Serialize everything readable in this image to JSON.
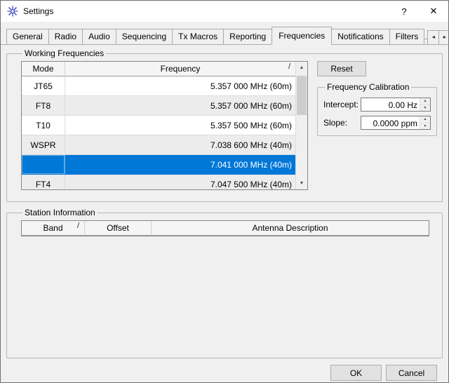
{
  "window": {
    "title": "Settings"
  },
  "titlebar": {
    "help": "?",
    "close": "✕"
  },
  "tabs": {
    "items": [
      {
        "label": "General"
      },
      {
        "label": "Radio"
      },
      {
        "label": "Audio"
      },
      {
        "label": "Sequencing"
      },
      {
        "label": "Tx Macros"
      },
      {
        "label": "Reporting"
      },
      {
        "label": "Frequencies"
      },
      {
        "label": "Notifications"
      },
      {
        "label": "Filters"
      }
    ],
    "active": "Frequencies"
  },
  "icons": {
    "scroll_left": "◄",
    "scroll_right": "►",
    "scrollbar_up": "▲",
    "scrollbar_down": "▼",
    "spin_up": "▲",
    "spin_down": "▼",
    "sort_indicator": "/"
  },
  "working_frequencies": {
    "title": "Working Frequencies",
    "columns": {
      "mode": "Mode",
      "frequency": "Frequency"
    },
    "rows": [
      {
        "mode": "JT65",
        "frequency": "5.357 000 MHz (60m)"
      },
      {
        "mode": "FT8",
        "frequency": "5.357 000 MHz (60m)"
      },
      {
        "mode": "T10",
        "frequency": "5.357 500 MHz (60m)"
      },
      {
        "mode": "WSPR",
        "frequency": "7.038 600 MHz (40m)"
      },
      {
        "mode": "",
        "frequency": "7.041 000 MHz (40m)",
        "selected": true
      },
      {
        "mode": "FT4",
        "frequency": "7.047 500 MHz (40m)"
      }
    ],
    "reset_button": "Reset"
  },
  "frequency_calibration": {
    "title": "Frequency Calibration",
    "intercept_label": "Intercept:",
    "intercept_value": "0.00 Hz",
    "slope_label": "Slope:",
    "slope_value": "0.0000 ppm"
  },
  "station_information": {
    "title": "Station Information",
    "columns": {
      "band": "Band",
      "offset": "Offset",
      "antenna": "Antenna Description"
    }
  },
  "footer": {
    "ok": "OK",
    "cancel": "Cancel"
  },
  "colors": {
    "selection_background": "#0078d7",
    "selection_text": "#ffffff"
  }
}
